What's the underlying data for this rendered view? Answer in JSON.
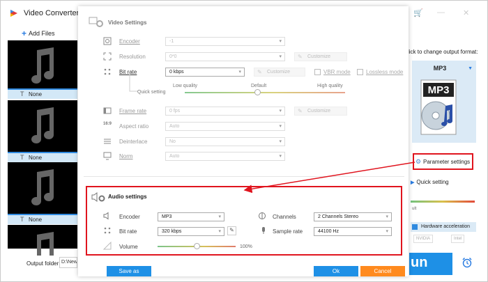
{
  "app": {
    "title": "Video Converter"
  },
  "left": {
    "add_files": "Add Files",
    "subtitle_items": [
      "None",
      "None",
      "None",
      "None"
    ],
    "output_folder_label": "Output folder:",
    "output_folder_value": "D:\\New fo"
  },
  "right": {
    "change_format_text": "lick to change output format:",
    "format": "MP3",
    "format_icon_text": "MP3",
    "parameter_settings": "Parameter settings",
    "quick_setting": "Quick setting",
    "slider_tick": "ult",
    "hw_accel": "Hardware acceleration",
    "gpu_nvidia": "NVIDIA",
    "gpu_intel": "Intel",
    "run_label": "un"
  },
  "video": {
    "title": "Video Settings",
    "encoder": {
      "label": "Encoder",
      "value": "-1"
    },
    "resolution": {
      "label": "Resolution",
      "value": "0*0",
      "customize": "Customize"
    },
    "bitrate": {
      "label": "Bit rate",
      "value": "0 kbps",
      "customize": "Customize",
      "vbr": "VBR mode",
      "lossless": "Lossless mode"
    },
    "quick": {
      "label": "Quick setting",
      "low": "Low quality",
      "default": "Default",
      "high": "High quality"
    },
    "framerate": {
      "label": "Frame rate",
      "value": "0 fps",
      "customize": "Customize"
    },
    "aspect": {
      "label": "Aspect ratio",
      "value": "Auto"
    },
    "deinterlace": {
      "label": "Deinterlace",
      "value": "No"
    },
    "norm": {
      "label": "Norm",
      "value": "Auto"
    }
  },
  "audio": {
    "title": "Audio settings",
    "encoder": {
      "label": "Encoder",
      "value": "MP3"
    },
    "channels": {
      "label": "Channels",
      "value": "2 Channels Stereo"
    },
    "bitrate": {
      "label": "Bit rate",
      "value": "320 kbps"
    },
    "samplerate": {
      "label": "Sample rate",
      "value": "44100 Hz"
    },
    "volume": {
      "label": "Volume",
      "value": "100%",
      "level": 0.5
    }
  },
  "buttons": {
    "save_as": "Save as",
    "ok": "Ok",
    "cancel": "Cancel"
  },
  "colors": {
    "accent": "#1e90e6",
    "highlight": "#e0141e",
    "cancel": "#ff8a1e"
  }
}
